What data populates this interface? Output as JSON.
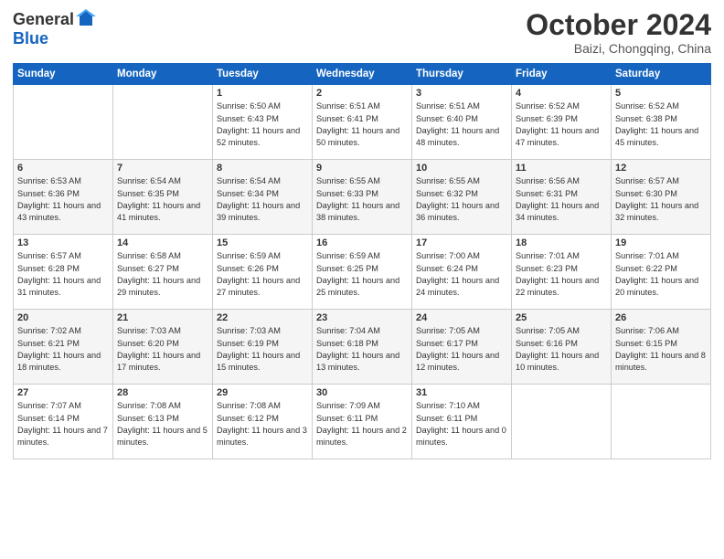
{
  "logo": {
    "general": "General",
    "blue": "Blue"
  },
  "title": "October 2024",
  "subtitle": "Baizi, Chongqing, China",
  "days_of_week": [
    "Sunday",
    "Monday",
    "Tuesday",
    "Wednesday",
    "Thursday",
    "Friday",
    "Saturday"
  ],
  "weeks": [
    [
      {
        "day": "",
        "sunrise": "",
        "sunset": "",
        "daylight": ""
      },
      {
        "day": "",
        "sunrise": "",
        "sunset": "",
        "daylight": ""
      },
      {
        "day": "1",
        "sunrise": "Sunrise: 6:50 AM",
        "sunset": "Sunset: 6:43 PM",
        "daylight": "Daylight: 11 hours and 52 minutes."
      },
      {
        "day": "2",
        "sunrise": "Sunrise: 6:51 AM",
        "sunset": "Sunset: 6:41 PM",
        "daylight": "Daylight: 11 hours and 50 minutes."
      },
      {
        "day": "3",
        "sunrise": "Sunrise: 6:51 AM",
        "sunset": "Sunset: 6:40 PM",
        "daylight": "Daylight: 11 hours and 48 minutes."
      },
      {
        "day": "4",
        "sunrise": "Sunrise: 6:52 AM",
        "sunset": "Sunset: 6:39 PM",
        "daylight": "Daylight: 11 hours and 47 minutes."
      },
      {
        "day": "5",
        "sunrise": "Sunrise: 6:52 AM",
        "sunset": "Sunset: 6:38 PM",
        "daylight": "Daylight: 11 hours and 45 minutes."
      }
    ],
    [
      {
        "day": "6",
        "sunrise": "Sunrise: 6:53 AM",
        "sunset": "Sunset: 6:36 PM",
        "daylight": "Daylight: 11 hours and 43 minutes."
      },
      {
        "day": "7",
        "sunrise": "Sunrise: 6:54 AM",
        "sunset": "Sunset: 6:35 PM",
        "daylight": "Daylight: 11 hours and 41 minutes."
      },
      {
        "day": "8",
        "sunrise": "Sunrise: 6:54 AM",
        "sunset": "Sunset: 6:34 PM",
        "daylight": "Daylight: 11 hours and 39 minutes."
      },
      {
        "day": "9",
        "sunrise": "Sunrise: 6:55 AM",
        "sunset": "Sunset: 6:33 PM",
        "daylight": "Daylight: 11 hours and 38 minutes."
      },
      {
        "day": "10",
        "sunrise": "Sunrise: 6:55 AM",
        "sunset": "Sunset: 6:32 PM",
        "daylight": "Daylight: 11 hours and 36 minutes."
      },
      {
        "day": "11",
        "sunrise": "Sunrise: 6:56 AM",
        "sunset": "Sunset: 6:31 PM",
        "daylight": "Daylight: 11 hours and 34 minutes."
      },
      {
        "day": "12",
        "sunrise": "Sunrise: 6:57 AM",
        "sunset": "Sunset: 6:30 PM",
        "daylight": "Daylight: 11 hours and 32 minutes."
      }
    ],
    [
      {
        "day": "13",
        "sunrise": "Sunrise: 6:57 AM",
        "sunset": "Sunset: 6:28 PM",
        "daylight": "Daylight: 11 hours and 31 minutes."
      },
      {
        "day": "14",
        "sunrise": "Sunrise: 6:58 AM",
        "sunset": "Sunset: 6:27 PM",
        "daylight": "Daylight: 11 hours and 29 minutes."
      },
      {
        "day": "15",
        "sunrise": "Sunrise: 6:59 AM",
        "sunset": "Sunset: 6:26 PM",
        "daylight": "Daylight: 11 hours and 27 minutes."
      },
      {
        "day": "16",
        "sunrise": "Sunrise: 6:59 AM",
        "sunset": "Sunset: 6:25 PM",
        "daylight": "Daylight: 11 hours and 25 minutes."
      },
      {
        "day": "17",
        "sunrise": "Sunrise: 7:00 AM",
        "sunset": "Sunset: 6:24 PM",
        "daylight": "Daylight: 11 hours and 24 minutes."
      },
      {
        "day": "18",
        "sunrise": "Sunrise: 7:01 AM",
        "sunset": "Sunset: 6:23 PM",
        "daylight": "Daylight: 11 hours and 22 minutes."
      },
      {
        "day": "19",
        "sunrise": "Sunrise: 7:01 AM",
        "sunset": "Sunset: 6:22 PM",
        "daylight": "Daylight: 11 hours and 20 minutes."
      }
    ],
    [
      {
        "day": "20",
        "sunrise": "Sunrise: 7:02 AM",
        "sunset": "Sunset: 6:21 PM",
        "daylight": "Daylight: 11 hours and 18 minutes."
      },
      {
        "day": "21",
        "sunrise": "Sunrise: 7:03 AM",
        "sunset": "Sunset: 6:20 PM",
        "daylight": "Daylight: 11 hours and 17 minutes."
      },
      {
        "day": "22",
        "sunrise": "Sunrise: 7:03 AM",
        "sunset": "Sunset: 6:19 PM",
        "daylight": "Daylight: 11 hours and 15 minutes."
      },
      {
        "day": "23",
        "sunrise": "Sunrise: 7:04 AM",
        "sunset": "Sunset: 6:18 PM",
        "daylight": "Daylight: 11 hours and 13 minutes."
      },
      {
        "day": "24",
        "sunrise": "Sunrise: 7:05 AM",
        "sunset": "Sunset: 6:17 PM",
        "daylight": "Daylight: 11 hours and 12 minutes."
      },
      {
        "day": "25",
        "sunrise": "Sunrise: 7:05 AM",
        "sunset": "Sunset: 6:16 PM",
        "daylight": "Daylight: 11 hours and 10 minutes."
      },
      {
        "day": "26",
        "sunrise": "Sunrise: 7:06 AM",
        "sunset": "Sunset: 6:15 PM",
        "daylight": "Daylight: 11 hours and 8 minutes."
      }
    ],
    [
      {
        "day": "27",
        "sunrise": "Sunrise: 7:07 AM",
        "sunset": "Sunset: 6:14 PM",
        "daylight": "Daylight: 11 hours and 7 minutes."
      },
      {
        "day": "28",
        "sunrise": "Sunrise: 7:08 AM",
        "sunset": "Sunset: 6:13 PM",
        "daylight": "Daylight: 11 hours and 5 minutes."
      },
      {
        "day": "29",
        "sunrise": "Sunrise: 7:08 AM",
        "sunset": "Sunset: 6:12 PM",
        "daylight": "Daylight: 11 hours and 3 minutes."
      },
      {
        "day": "30",
        "sunrise": "Sunrise: 7:09 AM",
        "sunset": "Sunset: 6:11 PM",
        "daylight": "Daylight: 11 hours and 2 minutes."
      },
      {
        "day": "31",
        "sunrise": "Sunrise: 7:10 AM",
        "sunset": "Sunset: 6:11 PM",
        "daylight": "Daylight: 11 hours and 0 minutes."
      },
      {
        "day": "",
        "sunrise": "",
        "sunset": "",
        "daylight": ""
      },
      {
        "day": "",
        "sunrise": "",
        "sunset": "",
        "daylight": ""
      }
    ]
  ]
}
